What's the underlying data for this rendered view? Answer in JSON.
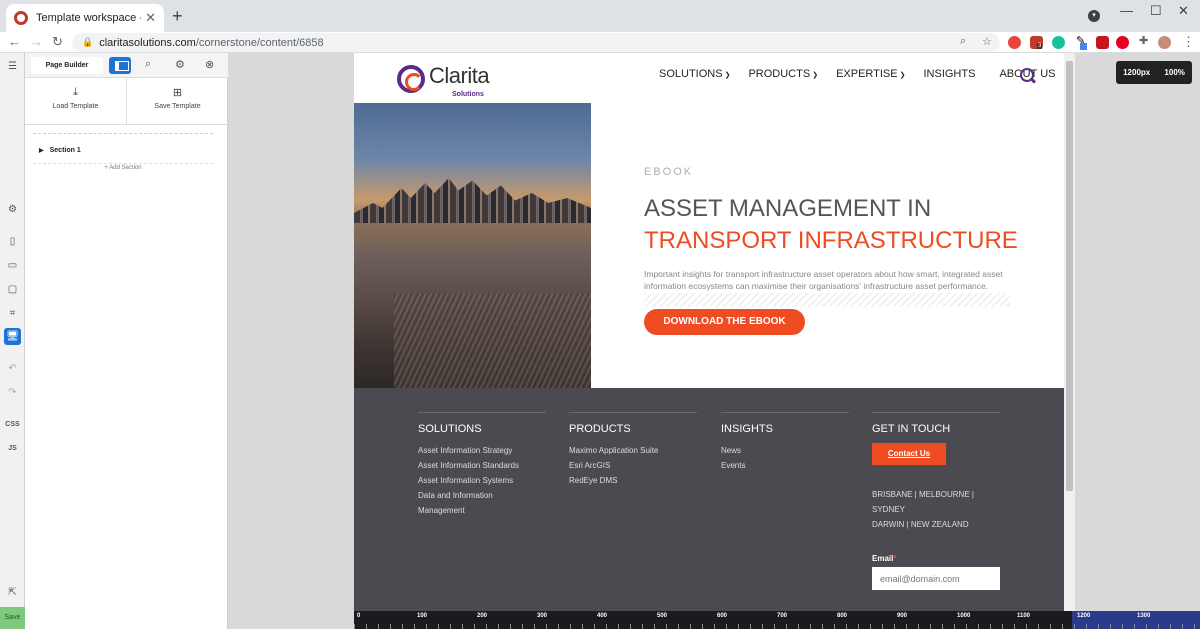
{
  "browser": {
    "tab_title": "Template workspace - Page Builder",
    "url_host": "claritasolutions.com",
    "url_path": "/cornerstone/content/6858",
    "ext_badge": "3"
  },
  "rail": {
    "css_label": "CSS",
    "js_label": "JS",
    "save_label": "Save"
  },
  "panel": {
    "tab_label": "Page Builder",
    "load_template": "Load Template",
    "save_template": "Save Template",
    "section_label": "Section 1",
    "add_section": "+ Add Section"
  },
  "viewport": {
    "width_label": "1200px",
    "zoom_label": "100%"
  },
  "site": {
    "logo_word": "Clarita",
    "logo_sub": "Solutions",
    "nav": [
      "SOLUTIONS",
      "PRODUCTS",
      "EXPERTISE",
      "INSIGHTS",
      "ABOUT US"
    ],
    "hero": {
      "tag": "EBOOK",
      "title_line1": "ASSET MANAGEMENT IN",
      "title_line2": "TRANSPORT INFRASTRUCTURE",
      "body": "Important insights for transport infrastructure asset operators about how smart, integrated asset information ecosystems can maximise their organisations' infrastructure asset performance.",
      "cta": "DOWNLOAD THE EBOOK"
    },
    "footer": {
      "solutions_title": "SOLUTIONS",
      "solutions_links": [
        "Asset Information Strategy",
        "Asset Information Standards",
        "Asset Information Systems",
        "Data and Information Management"
      ],
      "products_title": "PRODUCTS",
      "products_links": [
        "Maximo Application Suite",
        "Esri ArcGIS",
        "RedEye DMS"
      ],
      "insights_title": "INSIGHTS",
      "insights_links": [
        "News",
        "Events"
      ],
      "contact_title": "GET IN TOUCH",
      "contact_btn": "Contact Us",
      "locations_line1": "BRISBANE | MELBOURNE |",
      "locations_line2": "SYDNEY",
      "locations_line3": "DARWIN | NEW ZEALAND",
      "email_label": "Email",
      "email_required": "*",
      "email_placeholder": "email@domain.com"
    }
  },
  "ruler_marks": [
    "0",
    "100",
    "200",
    "300",
    "400",
    "500",
    "600",
    "700",
    "800",
    "900",
    "1000",
    "1100",
    "1200",
    "1300"
  ],
  "colors": {
    "brand_orange": "#ef4c23",
    "brand_purple": "#5b2c86",
    "footer_bg": "#4a4a50",
    "builder_blue": "#1e73d6"
  }
}
